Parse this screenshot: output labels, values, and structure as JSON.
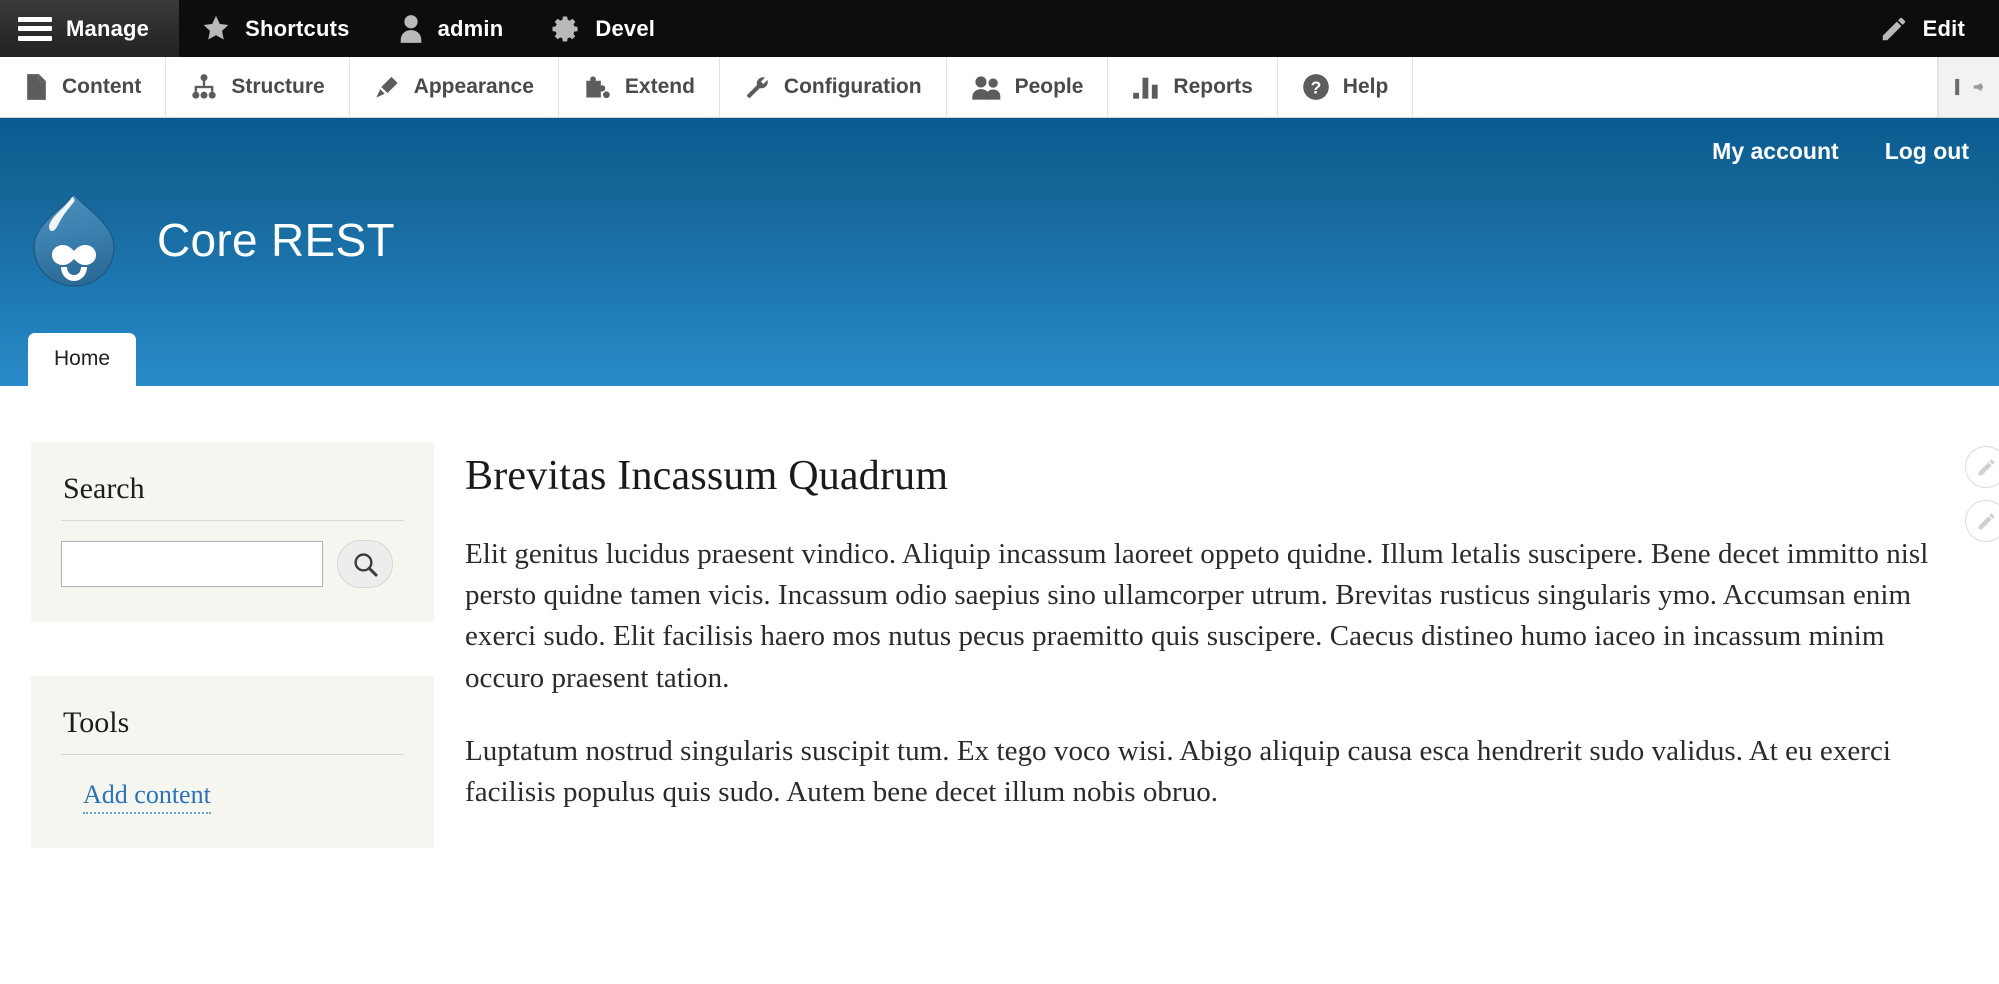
{
  "toolbar": {
    "tabs": [
      {
        "label": "Manage",
        "icon": "hamburger-icon",
        "active": true
      },
      {
        "label": "Shortcuts",
        "icon": "star-icon",
        "active": false
      },
      {
        "label": "admin",
        "icon": "user-icon",
        "active": false
      },
      {
        "label": "Devel",
        "icon": "gear-icon",
        "active": false
      }
    ],
    "edit": {
      "label": "Edit",
      "icon": "pencil-icon"
    }
  },
  "admin_menu": {
    "items": [
      {
        "label": "Content",
        "icon": "document-icon"
      },
      {
        "label": "Structure",
        "icon": "structure-icon"
      },
      {
        "label": "Appearance",
        "icon": "paintbrush-icon"
      },
      {
        "label": "Extend",
        "icon": "puzzle-icon"
      },
      {
        "label": "Configuration",
        "icon": "wrench-icon"
      },
      {
        "label": "People",
        "icon": "people-icon"
      },
      {
        "label": "Reports",
        "icon": "bar-chart-icon"
      },
      {
        "label": "Help",
        "icon": "question-mark-icon"
      }
    ],
    "toggle_icon": "collapse-to-vertical-icon"
  },
  "site_header": {
    "site_name": "Core REST",
    "logo_icon": "drupal-droplet-logo",
    "user_links": [
      {
        "label": "My account"
      },
      {
        "label": "Log out"
      }
    ],
    "primary_tabs": [
      {
        "label": "Home",
        "active": true
      }
    ]
  },
  "sidebar": {
    "search_block": {
      "title": "Search",
      "input_value": "",
      "input_placeholder": "",
      "submit_icon": "magnifier-icon"
    },
    "tools_block": {
      "title": "Tools",
      "links": [
        {
          "label": "Add content"
        }
      ]
    }
  },
  "main": {
    "node": {
      "title": "Brevitas Incassum Quadrum",
      "paragraphs": [
        "Elit genitus lucidus praesent vindico. Aliquip incassum laoreet oppeto quidne. Illum letalis suscipere. Bene decet immitto nisl persto quidne tamen vicis. Incassum odio saepius sino ullamcorper utrum. Brevitas rusticus singularis ymo. Accumsan enim exerci sudo. Elit facilisis haero mos nutus pecus praemitto quis suscipere. Caecus distineo humo iaceo in incassum minim occuro praesent tation.",
        "Luptatum nostrud singularis suscipit tum. Ex tego voco wisi. Abigo aliquip causa esca hendrerit sudo validus. At eu exerci facilisis populus quis sudo. Autem bene decet illum nobis obruo."
      ]
    },
    "contextual_buttons": [
      {
        "icon": "pencil-icon"
      },
      {
        "icon": "pencil-icon"
      }
    ]
  },
  "colors": {
    "toolbar_bg": "#0d0d0d",
    "toolbar_active_bg": "#2f2f2f",
    "tray_bg": "#ffffff",
    "header_blue_top": "#0a5c90",
    "header_blue_bottom": "#2a8bca",
    "block_bg": "#f6f6f1",
    "link_blue": "#2a74b5",
    "text_dark": "#2b2b2b"
  }
}
